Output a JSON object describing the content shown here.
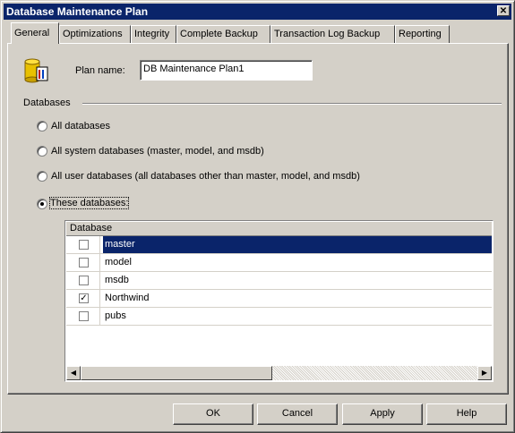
{
  "window": {
    "title": "Database Maintenance Plan",
    "close_label": "✕"
  },
  "tabs": [
    {
      "label": "General"
    },
    {
      "label": "Optimizations"
    },
    {
      "label": "Integrity"
    },
    {
      "label": "Complete Backup"
    },
    {
      "label": "Transaction Log Backup"
    },
    {
      "label": "Reporting"
    }
  ],
  "plan": {
    "label": "Plan name:",
    "value": "DB Maintenance Plan1",
    "icon": "database-plan-icon"
  },
  "databases_group": {
    "label": "Databases",
    "options": [
      {
        "label": "All databases",
        "checked": false
      },
      {
        "label": "All system databases (master, model, and msdb)",
        "checked": false
      },
      {
        "label": "All user databases (all databases other than master, model, and msdb)",
        "checked": false
      },
      {
        "label": "These databases:",
        "checked": true
      }
    ]
  },
  "grid": {
    "header": "Database",
    "rows": [
      {
        "name": "master",
        "checked": false,
        "selected": true
      },
      {
        "name": "model",
        "checked": false,
        "selected": false
      },
      {
        "name": "msdb",
        "checked": false,
        "selected": false
      },
      {
        "name": "Northwind",
        "checked": true,
        "selected": false
      },
      {
        "name": "pubs",
        "checked": false,
        "selected": false
      }
    ]
  },
  "buttons": {
    "ok": "OK",
    "cancel": "Cancel",
    "apply": "Apply",
    "help": "Help"
  },
  "colors": {
    "titlebar": "#0a246a",
    "face": "#d4d0c8",
    "selection": "#0a246a"
  }
}
